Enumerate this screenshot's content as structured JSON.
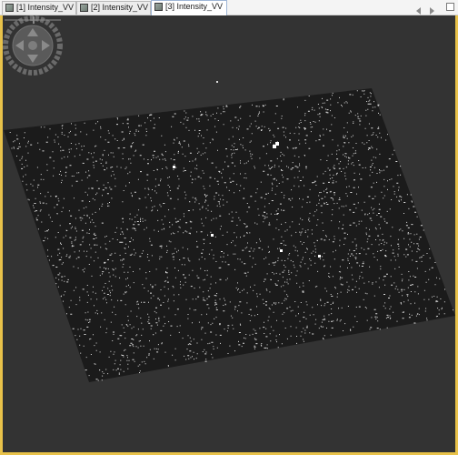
{
  "tabs": [
    {
      "label": "[1] Intensity_VV",
      "active": false
    },
    {
      "label": "[2] Intensity_VV",
      "active": false
    },
    {
      "label": "[3] Intensity_VV",
      "active": true
    }
  ],
  "tab_icon": "image-view-icon",
  "nav": {
    "prev_icon": "chevron-left-icon",
    "next_icon": "chevron-right-icon",
    "restore_icon": "restore-window-icon"
  },
  "navigation_controls": {
    "pan_icon": "pan-compass-icon",
    "zoom_icon": "zoom-slider-icon"
  },
  "colors": {
    "viewport_bg": "#333333",
    "active_border": "#e8c24a",
    "image_speckle": "#ffffff",
    "image_dark": "#1b1b1b"
  }
}
